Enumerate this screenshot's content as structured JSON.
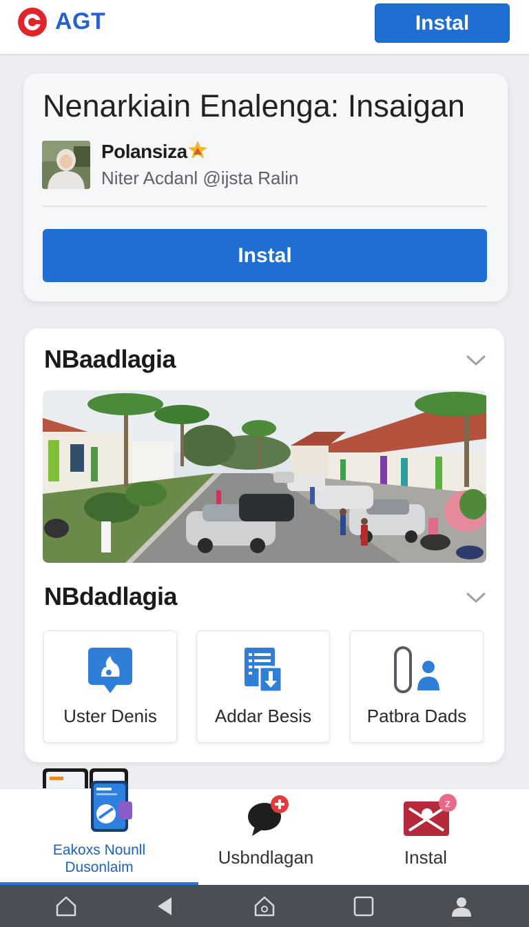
{
  "app": {
    "brand": "AGT",
    "top_install_label": "Instal"
  },
  "listing": {
    "title": "Nenarkiain Enalenga: Insaigan",
    "author_name": "Polansiza",
    "author_handle": "Niter Acdanl @ijsta Ralin",
    "install_label": "Instal"
  },
  "section1": {
    "title": "NBaadlagia"
  },
  "section2": {
    "title": "NBdadlagia",
    "tiles": [
      {
        "label": "Uster Denis",
        "icon": "chat-bubble-icon"
      },
      {
        "label": "Addar Besis",
        "icon": "document-download-icon"
      },
      {
        "label": "Patbra Dads",
        "icon": "user-pill-icon"
      }
    ]
  },
  "bottom_nav": {
    "items": [
      {
        "label_line1": "Eakoxs Nounll",
        "label_line2": "Dusonlaim",
        "icon": "phone-app-icon",
        "active": true
      },
      {
        "label": "Usbndlagan",
        "icon": "chat-plus-icon",
        "active": false
      },
      {
        "label": "Instal",
        "icon": "install-badge-icon",
        "active": false
      }
    ]
  },
  "system_nav": [
    "home-outline-icon",
    "back-icon",
    "home-icon",
    "recents-icon",
    "profile-icon"
  ],
  "colors": {
    "primary": "#1f6fd1",
    "brand_text": "#2563c9",
    "logo_red": "#e0242b",
    "active_nav": "#1f62b8",
    "system_bar": "#4a4f56"
  }
}
